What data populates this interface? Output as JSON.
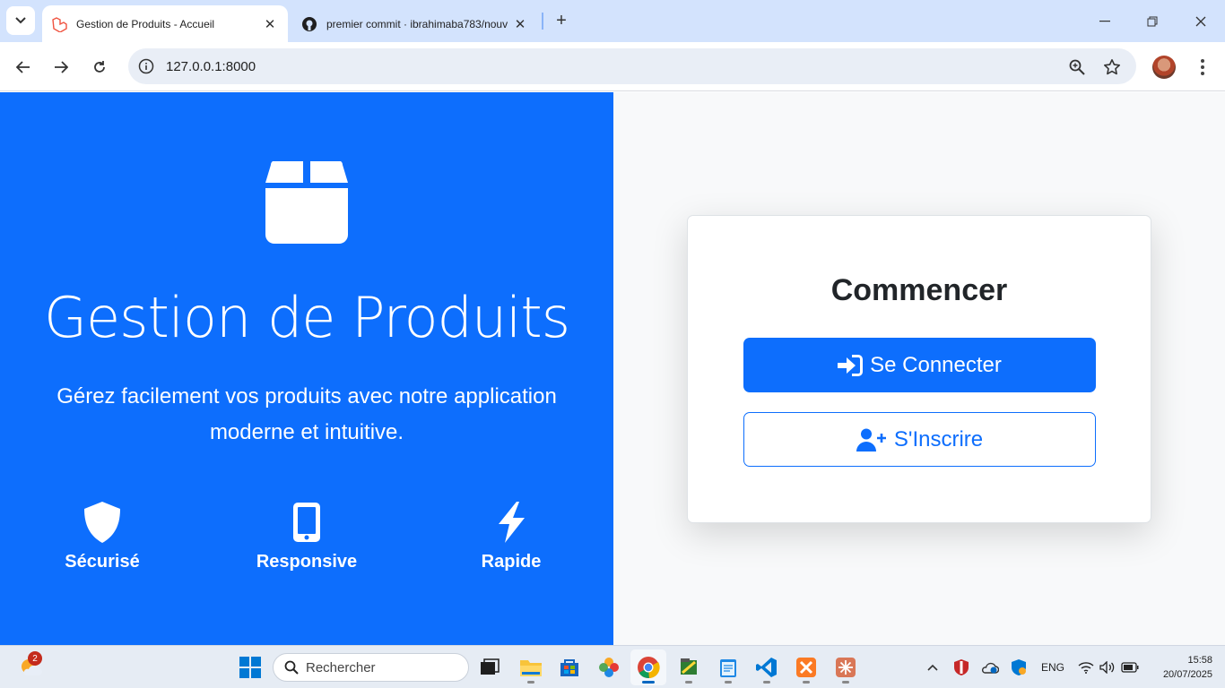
{
  "browser": {
    "tabs": [
      {
        "title": "Gestion de Produits - Accueil",
        "active": true
      },
      {
        "title": "premier commit · ibrahimaba783/nouv",
        "active": false
      }
    ],
    "url": "127.0.0.1:8000"
  },
  "hero": {
    "title": "Gestion de Produits",
    "subtitle": "Gérez facilement vos produits avec notre application moderne et intuitive.",
    "features": [
      {
        "label": "Sécurisé",
        "icon": "shield-icon"
      },
      {
        "label": "Responsive",
        "icon": "phone-icon"
      },
      {
        "label": "Rapide",
        "icon": "lightning-icon"
      }
    ]
  },
  "card": {
    "title": "Commencer",
    "login_label": "Se Connecter",
    "register_label": "S'Inscrire"
  },
  "taskbar": {
    "search_placeholder": "Rechercher",
    "weather_badge": "2",
    "language": "ENG",
    "time": "15:58",
    "date": "20/07/2025"
  },
  "colors": {
    "primary": "#0d6efd",
    "panel_bg": "#f8f9fa"
  }
}
